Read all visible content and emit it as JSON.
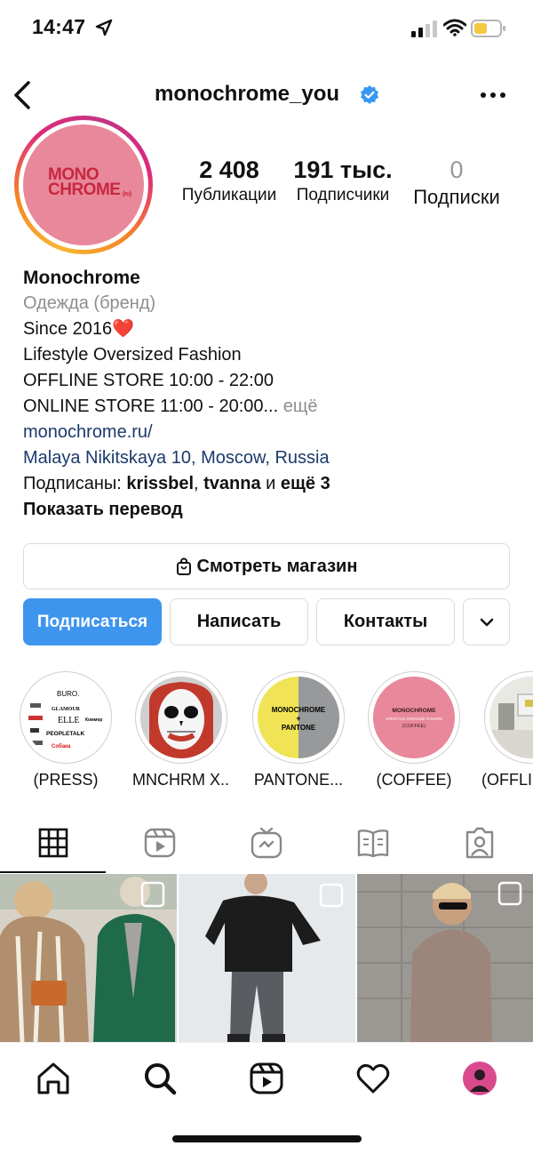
{
  "status_bar": {
    "time": "14:47"
  },
  "header": {
    "username": "monochrome_you"
  },
  "avatar": {
    "logo_line1": "MONO",
    "logo_line2": "CHROME",
    "logo_mark": "(ru)"
  },
  "stats": [
    {
      "value": "2 408",
      "label": "Публикации"
    },
    {
      "value": "191 тыс.",
      "label": "Подписчики"
    },
    {
      "value": "0",
      "label": "Подписки"
    }
  ],
  "bio": {
    "name": "Monochrome",
    "category": "Одежда (бренд)",
    "line1": "Since 2016❤️",
    "line2": "Lifestyle Oversized Fashion",
    "line3": "OFFLINE STORE 10:00 - 22:00",
    "line4": "ONLINE STORE 11:00 - 20:00...",
    "more": "ещё",
    "link": "monochrome.ru/",
    "address": "Malaya Nikitskaya 10, Moscow, Russia",
    "followed_prefix": "Подписаны:",
    "followed_user1": "krissbel",
    "followed_sep": ",",
    "followed_user2": "tvanna",
    "followed_and": "и",
    "followed_more": "ещё 3",
    "translate": "Показать перевод"
  },
  "buttons": {
    "shop": "Смотреть магазин",
    "follow": "Подписаться",
    "message": "Написать",
    "contacts": "Контакты"
  },
  "highlights": [
    {
      "label": "(PRESS)"
    },
    {
      "label": "MNCHRM X..."
    },
    {
      "label": "PANTONE..."
    },
    {
      "label": "(COFFEE)"
    },
    {
      "label": "(OFFLI"
    }
  ],
  "highlight_texts": {
    "press_logos": [
      "BURO.",
      "GLAMOUR",
      "ELLE",
      "Коммер",
      "PEOPLETALK",
      "Собака"
    ],
    "pantone_brand": "MONOCHROME",
    "pantone_plus": "+",
    "pantone_name": "PANTONE",
    "coffee_brand": "MONOCHROME",
    "coffee_sub": "LIFESTYLE OVERSIZE FASHION",
    "coffee_tag": "(COFFEE)"
  },
  "colors": {
    "accent": "#3d95ee",
    "verified": "#3897f0",
    "link": "#1b3a6b",
    "avatar_bg": "#e8889a",
    "logo": "#c8273f"
  },
  "icons": {
    "tabs": [
      "grid-icon",
      "reels-icon",
      "igtv-icon",
      "guides-icon",
      "tagged-icon"
    ],
    "nav": [
      "home-icon",
      "search-icon",
      "reels-icon",
      "heart-icon",
      "profile-avatar"
    ]
  }
}
